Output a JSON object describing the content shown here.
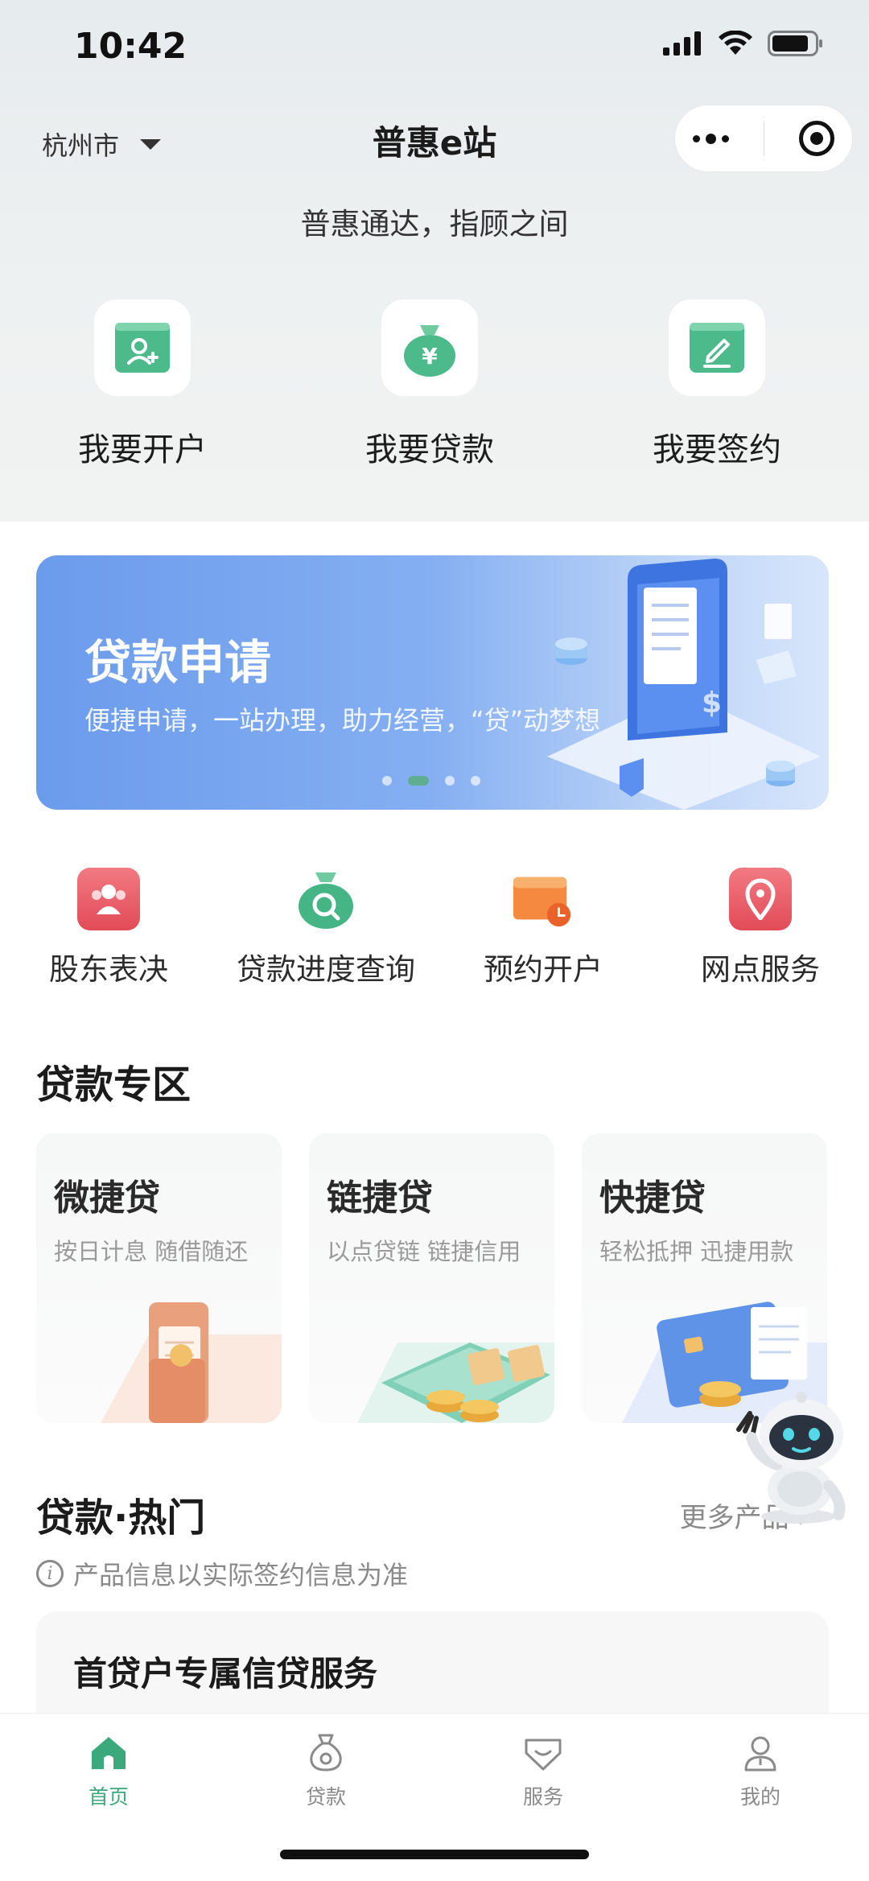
{
  "status_bar": {
    "time": "10:42"
  },
  "navbar": {
    "city": "杭州市",
    "title": "普惠e站"
  },
  "slogan": "普惠通达，指顾之间",
  "quick_actions": [
    {
      "label": "我要开户",
      "icon": "add-user-card-icon"
    },
    {
      "label": "我要贷款",
      "icon": "money-bag-yen-icon"
    },
    {
      "label": "我要签约",
      "icon": "sign-pen-icon"
    }
  ],
  "banner": {
    "title": "贷款申请",
    "subtitle": "便捷申请，一站办理，助力经营，“贷”动梦想",
    "slide_count": 4,
    "active_slide": 2
  },
  "services": [
    {
      "label": "股东表决",
      "icon": "shareholders-icon",
      "color": "#e8505b"
    },
    {
      "label": "贷款进度查询",
      "icon": "loan-search-icon",
      "color": "#3fb47f"
    },
    {
      "label": "预约开户",
      "icon": "calendar-clock-icon",
      "color": "#f07a36"
    },
    {
      "label": "网点服务",
      "icon": "location-pin-icon",
      "color": "#e84a5f"
    }
  ],
  "loan_zone": {
    "title": "贷款专区",
    "cards": [
      {
        "name": "微捷贷",
        "desc": "按日计息 随借随还"
      },
      {
        "name": "链捷贷",
        "desc": "以点贷链 链捷信用"
      },
      {
        "name": "快捷贷",
        "desc": "轻松抵押 迅捷用款"
      }
    ]
  },
  "hot": {
    "title": "贷款·热门",
    "more": "更多产品",
    "note": "产品信息以实际签约信息为准",
    "first_product": "首贷户专属信贷服务"
  },
  "tabbar": [
    {
      "label": "首页",
      "icon": "home-icon",
      "active": true
    },
    {
      "label": "贷款",
      "icon": "loan-bag-icon",
      "active": false
    },
    {
      "label": "服务",
      "icon": "service-heart-icon",
      "active": false
    },
    {
      "label": "我的",
      "icon": "profile-icon",
      "active": false
    }
  ],
  "colors": {
    "brand_green": "#3ba97b",
    "banner_blue": "#6b9bec"
  }
}
